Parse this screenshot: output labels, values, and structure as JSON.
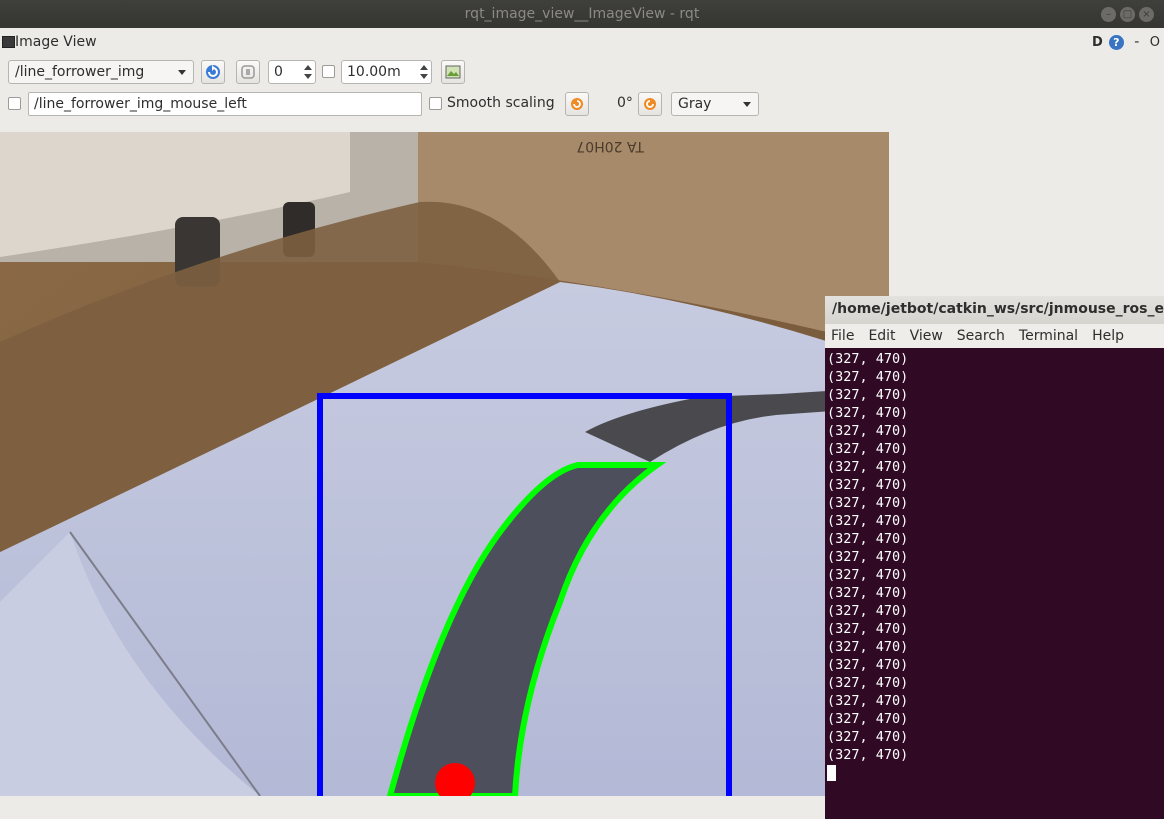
{
  "window": {
    "title": "rqt_image_view__ImageView - rqt",
    "buttons": [
      "–",
      "□",
      "×"
    ]
  },
  "plugin": {
    "title": "Image View",
    "d_label": "D",
    "help_label": "?",
    "minimize_label": "-",
    "close_label": "O"
  },
  "toolbar": {
    "topic": "/line_forrower_img",
    "refresh_icon": "refresh-icon",
    "spin_value": "0",
    "timeout_value": "10.00m",
    "save_icon": "save-image-icon",
    "mouse_topic": "/line_forrower_img_mouse_left",
    "smooth_scaling_label": "Smooth scaling",
    "rotation_label": "0°",
    "color_scheme": "Gray"
  },
  "image_text": {
    "box_print": "TA 20H07"
  },
  "colors": {
    "roi_box": "#0000ff",
    "contour": "#00ff00",
    "centroid": "#ff0000",
    "terminal_bg": "#300a24"
  },
  "terminal": {
    "title": "/home/jetbot/catkin_ws/src/jnmouse_ros_exan",
    "menu": [
      "File",
      "Edit",
      "View",
      "Search",
      "Terminal",
      "Help"
    ],
    "lines": [
      "(327, 470)",
      "(327, 470)",
      "(327, 470)",
      "(327, 470)",
      "(327, 470)",
      "(327, 470)",
      "(327, 470)",
      "(327, 470)",
      "(327, 470)",
      "(327, 470)",
      "(327, 470)",
      "(327, 470)",
      "(327, 470)",
      "(327, 470)",
      "(327, 470)",
      "(327, 470)",
      "(327, 470)",
      "(327, 470)",
      "(327, 470)",
      "(327, 470)",
      "(327, 470)",
      "(327, 470)",
      "(327, 470)"
    ]
  }
}
